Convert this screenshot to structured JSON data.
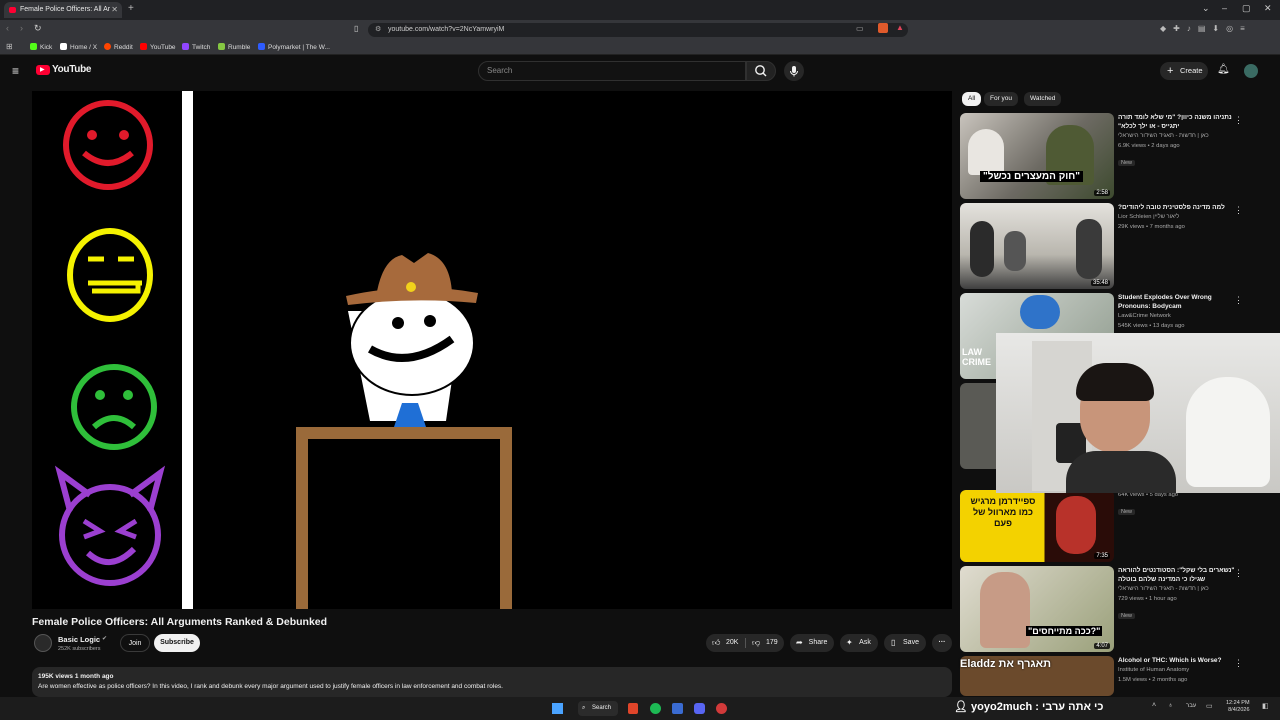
{
  "browser": {
    "tab_title": "Female Police Officers: All Ar",
    "url": "youtube.com/watch?v=2NcYamwryiM",
    "bookmarks": [
      {
        "label": "Kick",
        "color": "#53fc18"
      },
      {
        "label": "Home / X",
        "color": "#ffffff"
      },
      {
        "label": "Reddit",
        "color": "#ff4500"
      },
      {
        "label": "YouTube",
        "color": "#ff0000"
      },
      {
        "label": "Twitch",
        "color": "#9146ff"
      },
      {
        "label": "Rumble",
        "color": "#85c742"
      },
      {
        "label": "Polymarket | The W...",
        "color": "#2e5cff"
      }
    ]
  },
  "youtube": {
    "logo_text": "YouTube",
    "search_placeholder": "Search",
    "create_label": "Create"
  },
  "video": {
    "title": "Female Police Officers: All Arguments Ranked & Debunked",
    "channel": "Basic Logic",
    "subscribers": "252K subscribers",
    "join_label": "Join",
    "subscribe_label": "Subscribe",
    "likes": "20K",
    "dislikes": "179",
    "share_label": "Share",
    "ask_label": "Ask",
    "save_label": "Save",
    "views_date": "195K views  1 month ago",
    "description": "Are women effective as police officers? In this video, I rank and debunk every major argument used to justify female officers in law enforcement and combat roles."
  },
  "filters": [
    "All",
    "For you",
    "Watched"
  ],
  "recommendations": [
    {
      "title": "נתניהו משנה כיוון? \"מי שלא לומד תורה יתגייס - או ילך לכלא\"",
      "channel": "כאן | חדשות - תאגיד השידור הישראלי",
      "views": "6.9K views • 2 days ago",
      "badge": "New",
      "duration": "2:58",
      "thumb_text": "\"חוק המעצרים נכשל\""
    },
    {
      "title": "למה מדינה פלסטינית טובה ליהודים?",
      "channel": "Lior Schleien ליאור שליין",
      "views": "29K views • 7 months ago",
      "badge": "",
      "duration": "35:48",
      "thumb_text": ""
    },
    {
      "title": "Student Explodes Over Wrong Pronouns: Bodycam",
      "channel": "Law&Crime Network",
      "views": "545K views • 13 days ago",
      "badge": "",
      "duration": "",
      "thumb_text": "LAW CRIME"
    },
    {
      "title": "",
      "channel": "",
      "views": "64K views • 5 days ago",
      "badge": "New",
      "duration": "7:35",
      "thumb_text": "ספיידרמן מרגיש כמו מארוול של פעם"
    },
    {
      "title": "\"נשארים בלי שקל\": הסטודנטים להוראה שגילו כי המדינה שלהם בוטלה",
      "channel": "כאן | חדשות - תאגיד השידור הישראלי",
      "views": "729 views • 1 hour ago",
      "badge": "New",
      "duration": "4:07",
      "thumb_text": "\"ככה מתייחסים?\""
    },
    {
      "title": "Alcohol or THC: Which is Worse?",
      "channel": "Institute of Human Anatomy",
      "views": "1.5M views • 2 months ago",
      "badge": "",
      "duration": "",
      "thumb_text": ""
    }
  ],
  "chat_overlay": {
    "line": "yoyo2much : כי אתה ערבי",
    "ticker": "Eladdz תאגרף את"
  },
  "taskbar": {
    "search_label": "Search",
    "lang": "עבר",
    "time": "12:24 PM",
    "date": "8/4/2026"
  },
  "colors": {
    "accent_red": "#ff0033",
    "face_red": "#e11a2b",
    "face_yellow": "#f5f200",
    "face_green": "#2fbf3a",
    "face_purple": "#9b3fd0",
    "hat_brown": "#a76a3c",
    "desk_brown": "#9a6a3a"
  }
}
